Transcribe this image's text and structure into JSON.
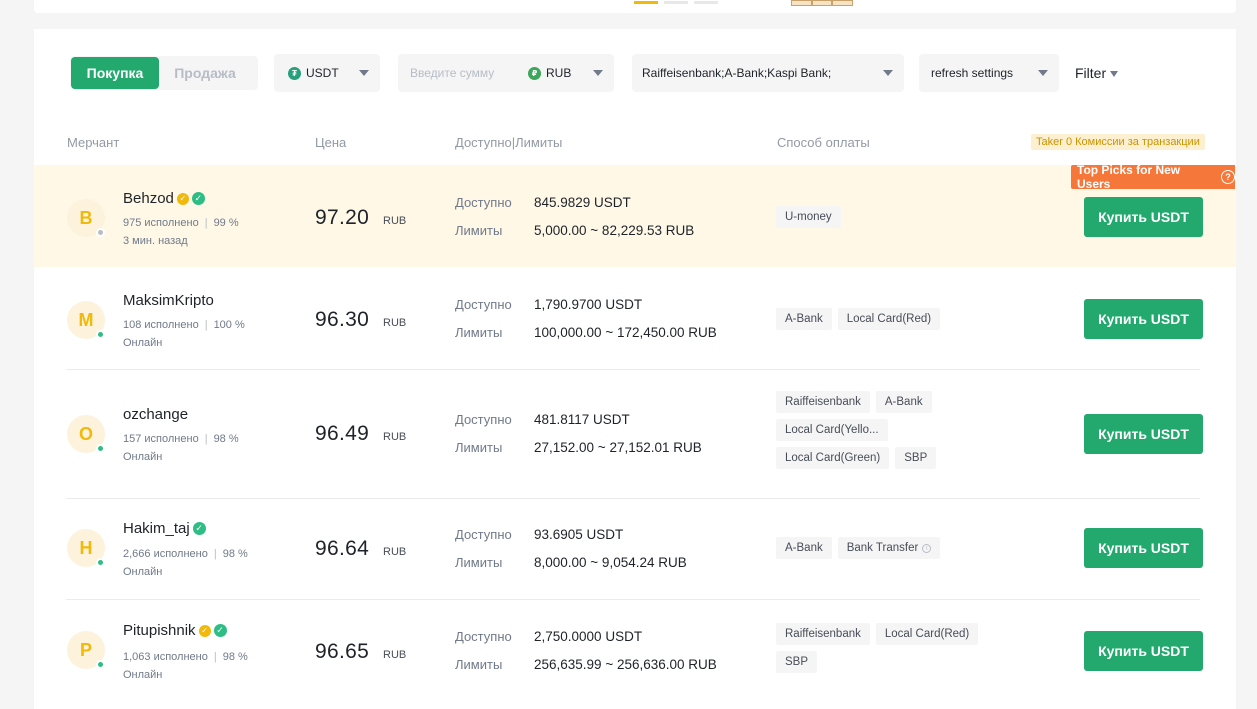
{
  "toolbar": {
    "buy_label": "Покупка",
    "sell_label": "Продажа",
    "crypto_currency": "USDT",
    "amount_placeholder": "Введите сумму",
    "fiat_currency": "RUB",
    "banks_selected": "Raiffeisenbank;A-Bank;Kaspi Bank;",
    "refresh_label": "refresh settings",
    "filter_label": "Filter"
  },
  "table_header": {
    "merchant": "Мерчант",
    "price": "Цена",
    "available_limits": "Доступно|Лимиты",
    "payment_method": "Способ оплаты",
    "taker_note": "Taker 0 Комиссии за транзакции"
  },
  "labels": {
    "available": "Доступно",
    "limits": "Лимиты",
    "buy_button": "Купить USDT",
    "top_picks": "Top Picks for New Users"
  },
  "rows": [
    {
      "initial": "B",
      "name": "Behzod",
      "orders": "975 исполнено",
      "completion": "99 %",
      "status": "3 мин. назад",
      "online": false,
      "price": "97.20",
      "price_currency": "RUB",
      "available": "845.9829 USDT",
      "limits": "5,000.00 ~ 82,229.53 RUB",
      "payments": [
        "U-money"
      ]
    },
    {
      "initial": "M",
      "name": "MaksimKripto",
      "orders": "108 исполнено",
      "completion": "100 %",
      "status": "Онлайн",
      "online": true,
      "price": "96.30",
      "price_currency": "RUB",
      "available": "1,790.9700 USDT",
      "limits": "100,000.00 ~ 172,450.00 RUB",
      "payments": [
        "A-Bank",
        "Local Card(Red)"
      ]
    },
    {
      "initial": "O",
      "name": "ozchange",
      "orders": "157 исполнено",
      "completion": "98 %",
      "status": "Онлайн",
      "online": true,
      "price": "96.49",
      "price_currency": "RUB",
      "available": "481.8117 USDT",
      "limits": "27,152.00 ~ 27,152.01 RUB",
      "payments": [
        "Raiffeisenbank",
        "A-Bank",
        "Local Card(Yello...",
        "Local Card(Green)",
        "SBP"
      ]
    },
    {
      "initial": "H",
      "name": "Hakim_taj",
      "orders": "2,666 исполнено",
      "completion": "98 %",
      "status": "Онлайн",
      "online": true,
      "price": "96.64",
      "price_currency": "RUB",
      "available": "93.6905 USDT",
      "limits": "8,000.00 ~ 9,054.24 RUB",
      "payments": [
        "A-Bank",
        "Bank Transfer"
      ]
    },
    {
      "initial": "P",
      "name": "Pitupishnik",
      "orders": "1,063 исполнено",
      "completion": "98 %",
      "status": "Онлайн",
      "online": true,
      "price": "96.65",
      "price_currency": "RUB",
      "available": "2,750.0000 USDT",
      "limits": "256,635.99 ~ 256,636.00 RUB",
      "payments": [
        "Raiffeisenbank",
        "Local Card(Red)",
        "SBP"
      ]
    }
  ]
}
